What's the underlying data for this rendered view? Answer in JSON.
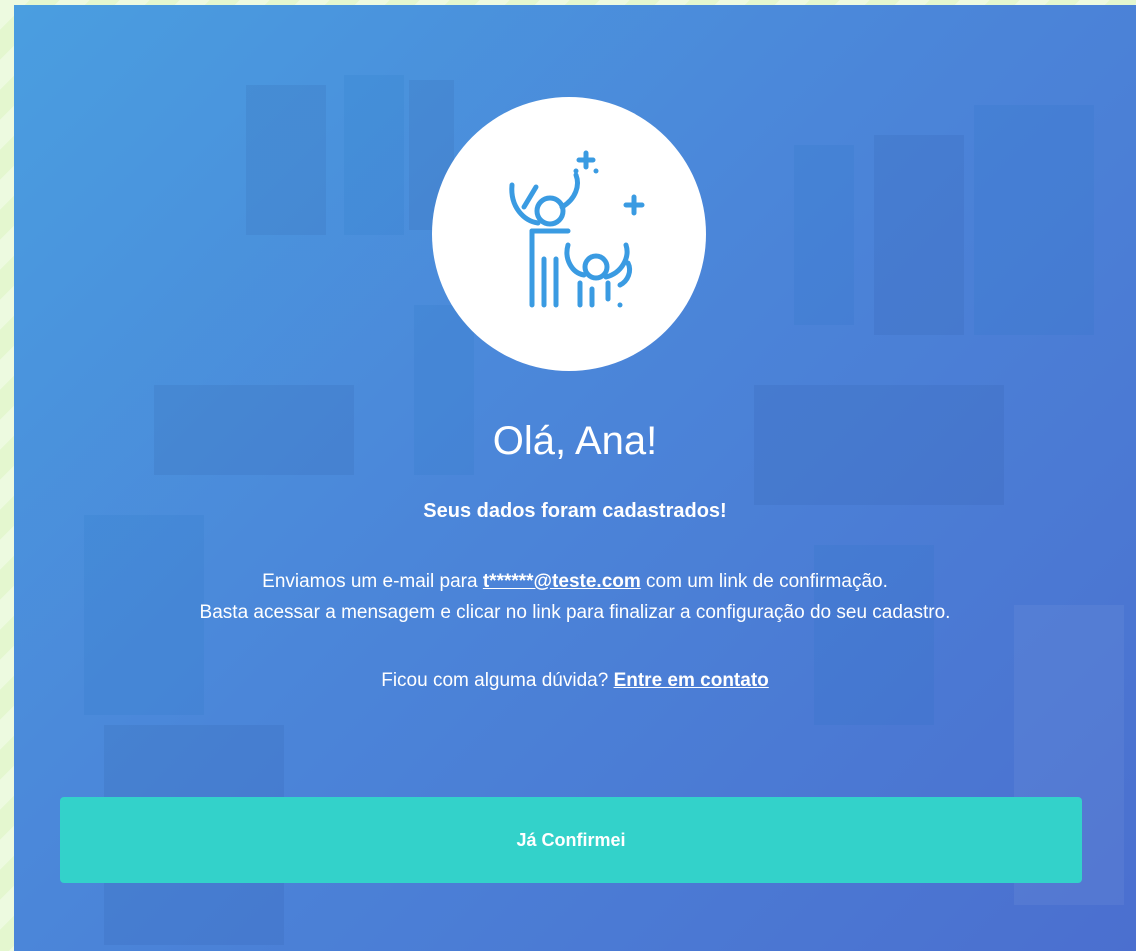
{
  "page": {
    "greeting": "Olá, Ana!",
    "subtitle": "Seus dados foram cadastrados!",
    "message": {
      "line1_prefix": "Enviamos um e-mail para ",
      "email": "t******@teste.com",
      "line1_suffix": " com um link de confirmação.",
      "line2": "Basta acessar a mensagem e clicar no link para finalizar a configuração do seu cadastro."
    },
    "help": {
      "question": "Ficou com alguma dúvida? ",
      "link_label": "Entre em contato"
    },
    "confirm_button_label": "Já Confirmei"
  },
  "icons": {
    "hero": "celebrating-people-icon"
  },
  "colors": {
    "background_gradient_start": "#4a9ee0",
    "background_gradient_end": "#4b6fcf",
    "button": "#33d2ca",
    "icon_stroke": "#3a9be2",
    "text": "#ffffff"
  }
}
